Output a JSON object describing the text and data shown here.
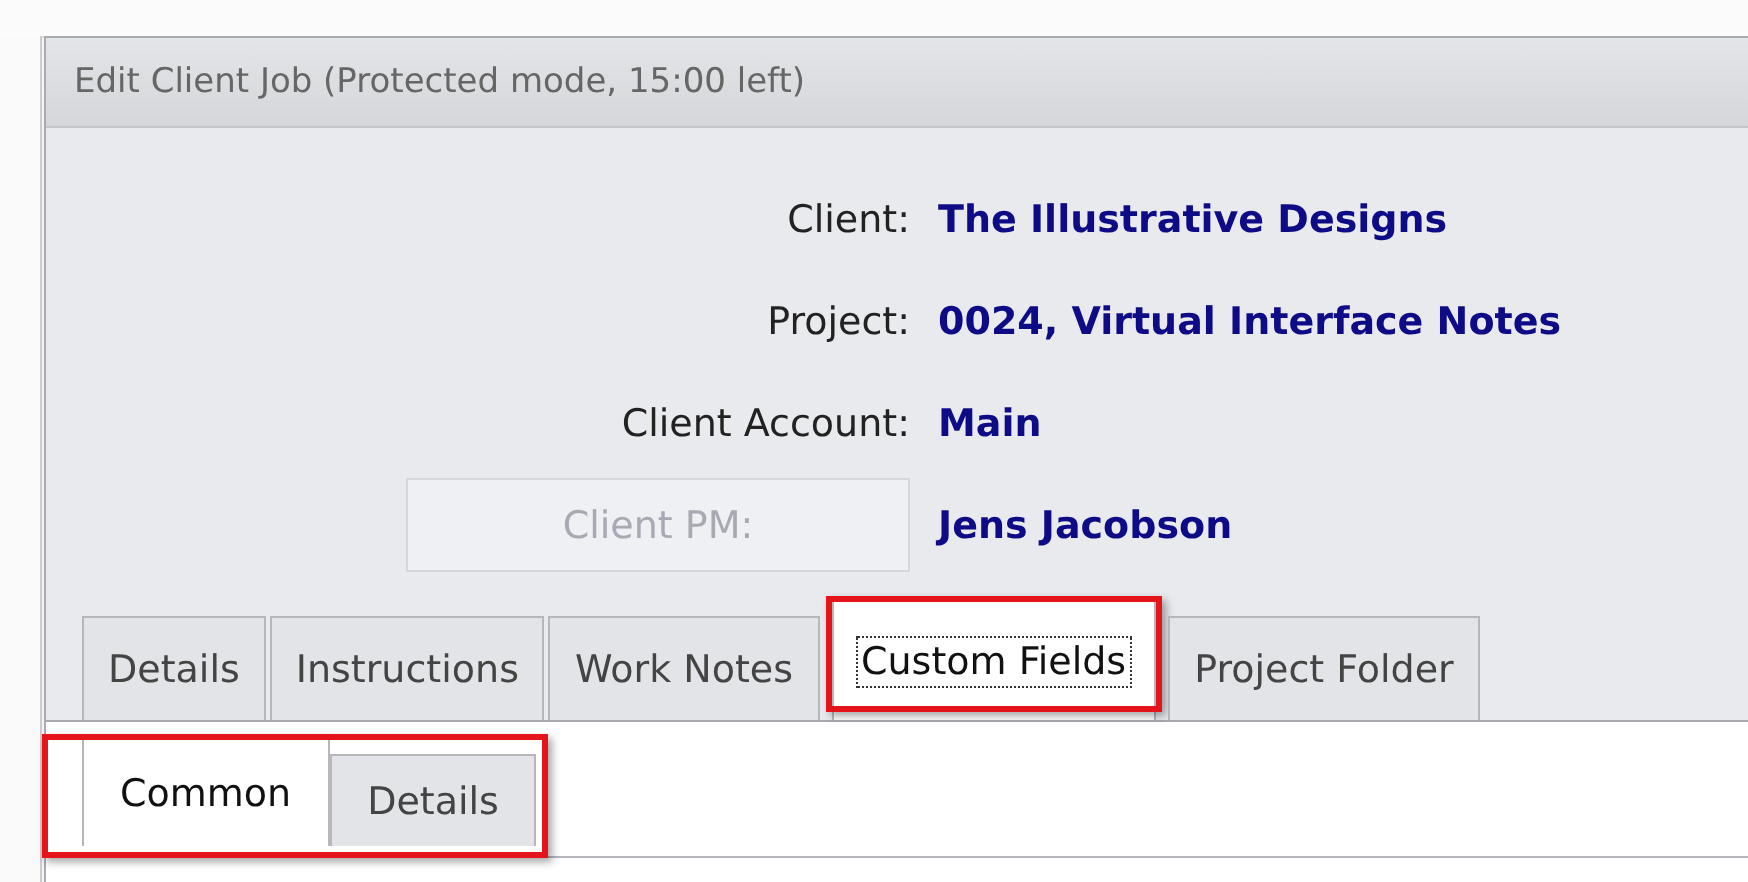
{
  "window": {
    "title": "Edit Client Job (Protected mode, 15:00 left)"
  },
  "fields": [
    {
      "kind": "label",
      "label": "Client:",
      "value": "The Illustrative Designs"
    },
    {
      "kind": "label",
      "label": "Project:",
      "value": "0024, Virtual Interface Notes"
    },
    {
      "kind": "label",
      "label": "Client Account:",
      "value": "Main"
    },
    {
      "kind": "button",
      "label": "Client PM:",
      "disabled": true,
      "value": "Jens Jacobson"
    }
  ],
  "tabs": [
    {
      "label": "Details",
      "selected": false,
      "highlighted": false
    },
    {
      "label": "Instructions",
      "selected": false,
      "highlighted": false
    },
    {
      "label": "Work Notes",
      "selected": false,
      "highlighted": false
    },
    {
      "label": "Custom Fields",
      "selected": true,
      "highlighted": true
    },
    {
      "label": "Project Folder",
      "selected": false,
      "highlighted": false
    }
  ],
  "subtabs": {
    "highlighted": true,
    "items": [
      {
        "label": "Common",
        "selected": true
      },
      {
        "label": "Details",
        "selected": false
      }
    ]
  }
}
